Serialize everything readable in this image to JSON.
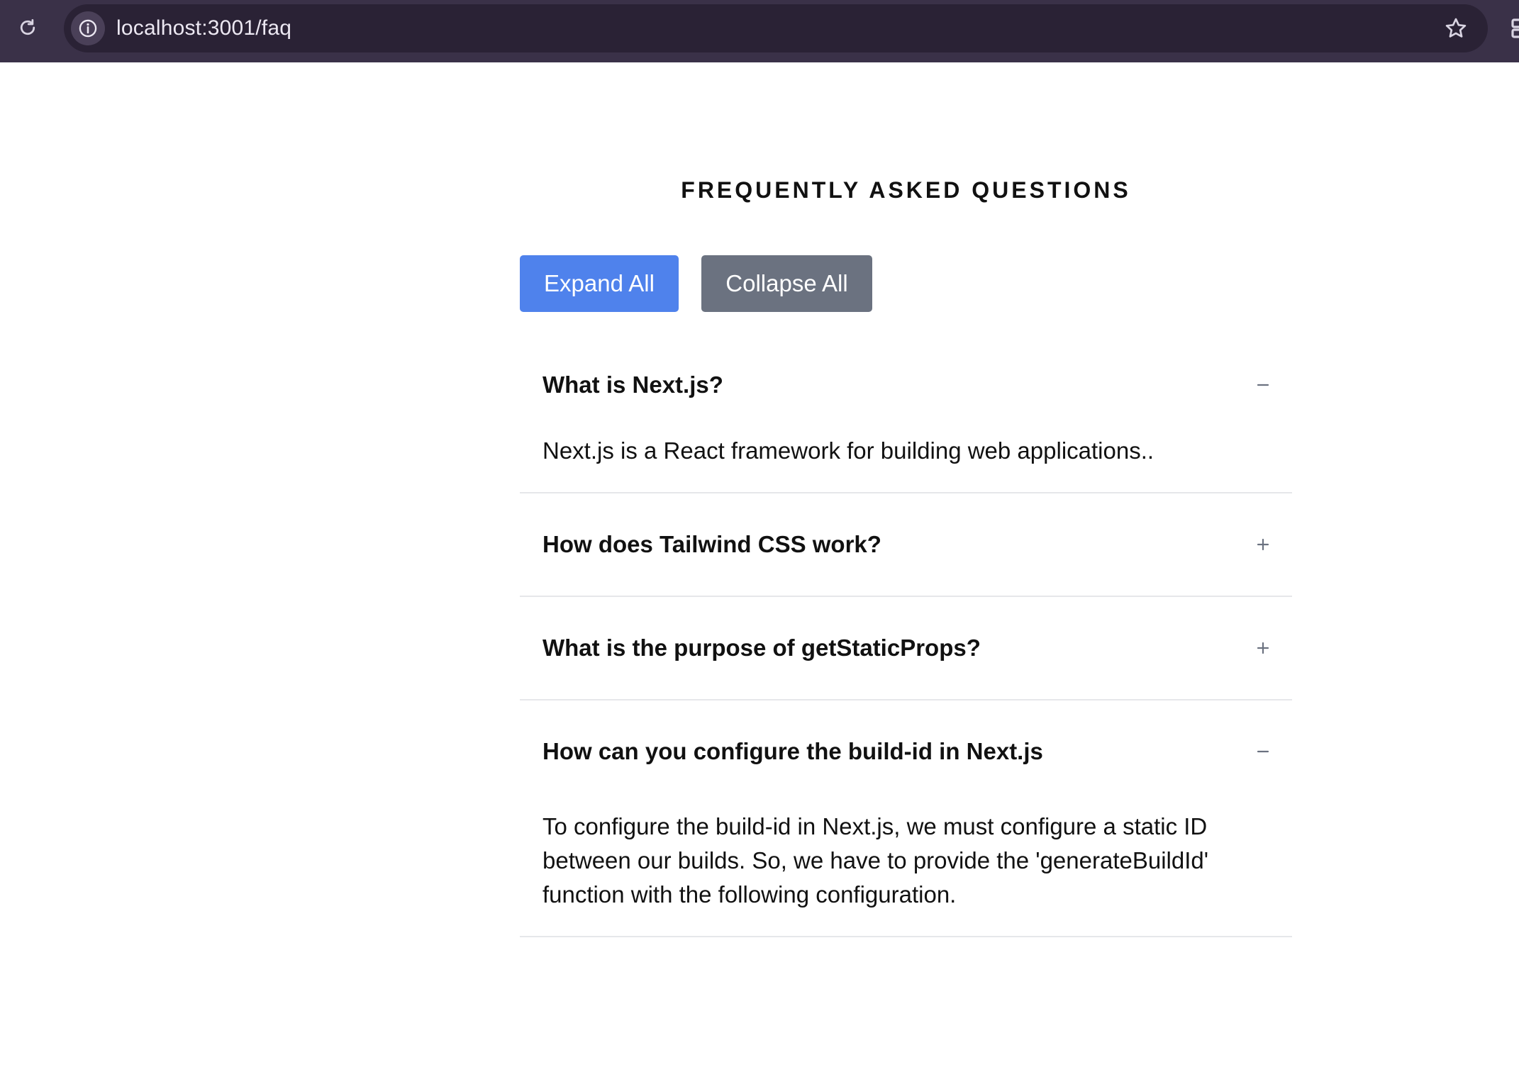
{
  "browser": {
    "url": "localhost:3001/faq",
    "icons": [
      "reload-icon",
      "info-icon",
      "star-icon",
      "extension-icon"
    ]
  },
  "page": {
    "title": "FREQUENTLY ASKED QUESTIONS",
    "expand_all_label": "Expand All",
    "collapse_all_label": "Collapse All"
  },
  "faqs": [
    {
      "question": "What is Next.js?",
      "expanded": true,
      "toggle_icon": "minus-icon",
      "answer": "Next.js is a React framework for building web applications.."
    },
    {
      "question": "How does Tailwind CSS work?",
      "expanded": false,
      "toggle_icon": "plus-icon"
    },
    {
      "question": "What is the purpose of getStaticProps?",
      "expanded": false,
      "toggle_icon": "plus-icon"
    },
    {
      "question": "How can you configure the build-id in Next.js",
      "expanded": true,
      "toggle_icon": "minus-icon",
      "answer": "To configure the build-id in Next.js, we must configure a static ID between our builds. So, we have to provide the 'generateBuildId' function with the following configuration."
    }
  ],
  "colors": {
    "browser_bar": "#3a3148",
    "omnibox": "#2a2235",
    "expand_button": "#4f82ec",
    "collapse_button": "#6b7280",
    "divider": "#e6e7ea"
  }
}
